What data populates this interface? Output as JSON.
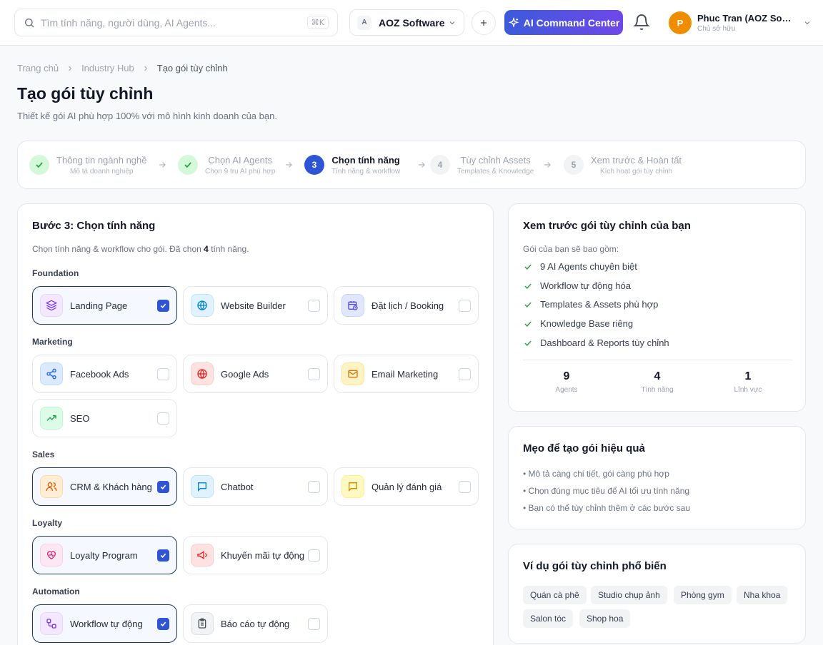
{
  "topbar": {
    "search_placeholder": "Tìm tính năng, người dùng, AI Agents...",
    "search_shortcut": "⌘K",
    "org_initial": "A",
    "org_name": "AOZ Software",
    "command_center_label": "AI Command Center",
    "user_initial": "P",
    "user_name": "Phuc Tran (AOZ Software)",
    "user_role": "Chủ sở hữu"
  },
  "breadcrumb": [
    "Trang chủ",
    "Industry Hub",
    "Tạo gói tùy chỉnh"
  ],
  "page": {
    "title": "Tạo gói tùy chỉnh",
    "subtitle": "Thiết kế gói AI phù hợp 100% với mô hình kinh doanh của bạn."
  },
  "steps": [
    {
      "title": "Thông tin ngành nghề",
      "desc": "Mô tả doanh nghiệp",
      "status": "done"
    },
    {
      "title": "Chọn AI Agents",
      "desc": "Chọn 9 trụ AI phù hợp",
      "status": "done"
    },
    {
      "number": "3",
      "title": "Chọn tính năng",
      "desc": "Tính năng & workflow",
      "status": "active"
    },
    {
      "number": "4",
      "title": "Tùy chỉnh Assets",
      "desc": "Templates & Knowledge",
      "status": "todo"
    },
    {
      "number": "5",
      "title": "Xem trước & Hoàn tất",
      "desc": "Kích hoạt gói tùy chỉnh",
      "status": "todo"
    }
  ],
  "features": {
    "title": "Bước 3: Chọn tính năng",
    "sub_prefix": "Chọn tính năng & workflow cho gói. Đã chọn",
    "selected_count": "4",
    "sub_suffix": "tính năng.",
    "groups": [
      {
        "label": "Foundation",
        "items": [
          {
            "label": "Landing Page",
            "icon": "layers-icon",
            "selected": true
          },
          {
            "label": "Website Builder",
            "icon": "globe-icon",
            "selected": false
          },
          {
            "label": "Đặt lịch / Booking",
            "icon": "calendar-clock-icon",
            "selected": false
          }
        ]
      },
      {
        "label": "Marketing",
        "items": [
          {
            "label": "Facebook Ads",
            "icon": "share-icon",
            "selected": false
          },
          {
            "label": "Google Ads",
            "icon": "globe-icon",
            "selected": false
          },
          {
            "label": "Email Marketing",
            "icon": "mail-icon",
            "selected": false
          },
          {
            "label": "SEO",
            "icon": "trending-up-icon",
            "selected": false
          }
        ]
      },
      {
        "label": "Sales",
        "items": [
          {
            "label": "CRM & Khách hàng",
            "icon": "users-icon",
            "selected": true
          },
          {
            "label": "Chatbot",
            "icon": "chat-icon",
            "selected": false
          },
          {
            "label": "Quản lý đánh giá",
            "icon": "chat-icon",
            "selected": false
          }
        ]
      },
      {
        "label": "Loyalty",
        "items": [
          {
            "label": "Loyalty Program",
            "icon": "heart-icon",
            "selected": true
          },
          {
            "label": "Khuyến mãi tự động",
            "icon": "megaphone-icon",
            "selected": false
          }
        ]
      },
      {
        "label": "Automation",
        "items": [
          {
            "label": "Workflow tự động",
            "icon": "workflow-icon",
            "selected": true
          },
          {
            "label": "Báo cáo tự động",
            "icon": "clipboard-icon",
            "selected": false
          }
        ]
      }
    ]
  },
  "preview": {
    "title": "Xem trước gói tùy chỉnh của bạn",
    "subtitle": "Gói của bạn sẽ bao gồm:",
    "includes": [
      "9 AI Agents chuyên biệt",
      "Workflow tự động hóa",
      "Templates & Assets phù hợp",
      "Knowledge Base riêng",
      "Dashboard & Reports tùy chỉnh"
    ],
    "stats": [
      {
        "value": "9",
        "label": "Agents"
      },
      {
        "value": "4",
        "label": "Tính năng"
      },
      {
        "value": "1",
        "label": "Lĩnh vực"
      }
    ]
  },
  "tips": {
    "title": "Mẹo để tạo gói hiệu quả",
    "items": [
      "• Mô tả càng chi tiết, gói càng phù hợp",
      "• Chọn đúng mục tiêu để AI tối ưu tính năng",
      "• Bạn có thể tùy chỉnh thêm ở các bước sau"
    ]
  },
  "examples": {
    "title": "Ví dụ gói tùy chỉnh phổ biến",
    "chips": [
      "Quán cà phê",
      "Studio chụp ảnh",
      "Phòng gym",
      "Nha khoa",
      "Salon tóc",
      "Shop hoa"
    ]
  },
  "colors": {
    "accent": "#2f55d4",
    "selected_border": "#1e3a5f",
    "success": "#2f9e44"
  }
}
